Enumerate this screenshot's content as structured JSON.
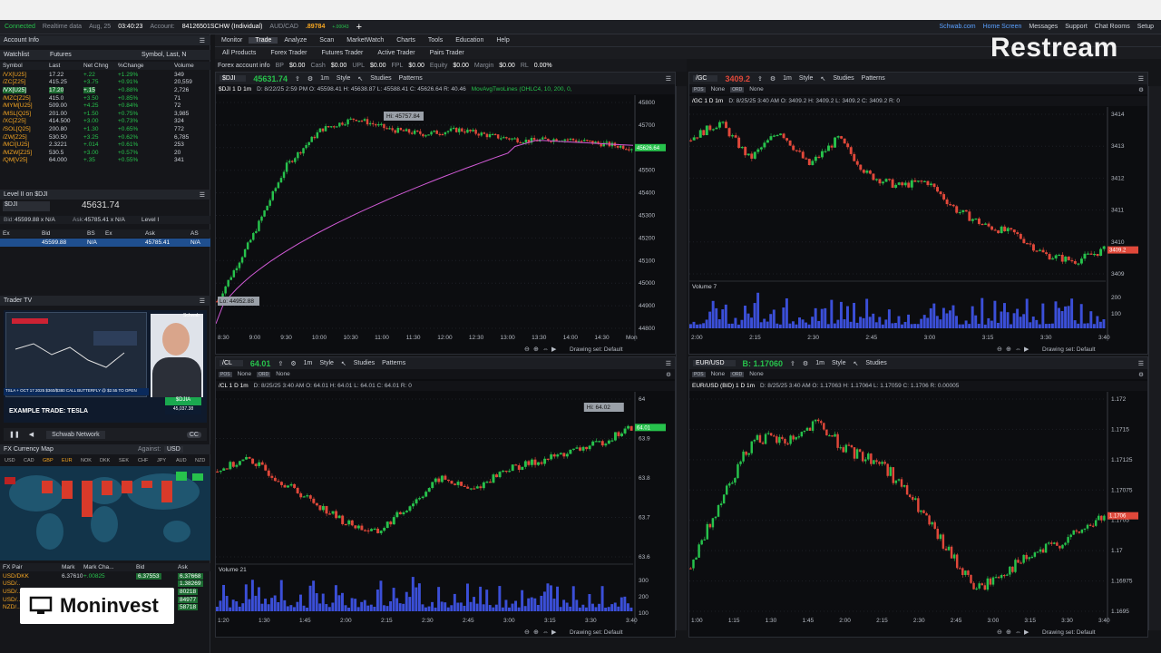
{
  "status": {
    "connected": "Connected",
    "realtime": "Realtime data",
    "date": "Aug, 25",
    "time": "03:40:23",
    "account_label": "Account:",
    "account": "84126501SCHW (Individual)",
    "pair": "AUD/CAD",
    "price": ".89784",
    "price_chg1": "+.00043",
    "price_chg2": "+0.05%"
  },
  "menu": {
    "items": [
      "Monitor",
      "Trade",
      "Analyze",
      "Scan",
      "MarketWatch",
      "Charts",
      "Tools",
      "Education",
      "Help"
    ],
    "active": "Trade"
  },
  "links": {
    "schwab": "Schwab.com",
    "home": "Home Screen",
    "messages": "Messages",
    "support": "Support",
    "chat": "Chat Rooms",
    "setup": "Setup",
    "ondemand": "OnDemand"
  },
  "subtabs": [
    "All Products",
    "Forex Trader",
    "Futures Trader",
    "Active Trader",
    "Pairs Trader"
  ],
  "fxinfo": {
    "label": "Forex account info",
    "bp": "BP",
    "bp_v": "$0.00",
    "cash": "Cash",
    "cash_v": "$0.00",
    "upl": "UPL",
    "upl_v": "$0.00",
    "fpl": "FPL",
    "fpl_v": "$0.00",
    "equity": "Equity",
    "equity_v": "$0.00",
    "margin": "Margin",
    "margin_v": "$0.00",
    "rl": "RL",
    "rl_v": "0.00%"
  },
  "left": {
    "account_info": "Account Info",
    "watchlist": {
      "title": "Watchlist",
      "list": "Futures",
      "sort": "Symbol, Last, N",
      "headers": [
        "Symbol",
        "Last",
        "Net Chng",
        "%Change",
        "Volume"
      ],
      "rows": [
        [
          "/VX[U25]",
          "17.22",
          "+.22",
          "+1.29%",
          "349"
        ],
        [
          "/ZC[Z25]",
          "415.25",
          "+3.75",
          "+0.91%",
          "20,559"
        ],
        [
          "/VX[U25]",
          "17.20",
          "+.15",
          "+0.88%",
          "2,726"
        ],
        [
          "/MZC[Z25]",
          "415.0",
          "+3.50",
          "+0.85%",
          "71"
        ],
        [
          "/MYM[U25]",
          "509.00",
          "+4.25",
          "+0.84%",
          "72"
        ],
        [
          "/MSL[Q25]",
          "201.00",
          "+1.50",
          "+0.75%",
          "3,985"
        ],
        [
          "/XC[Z25]",
          "414.500",
          "+3.00",
          "+0.73%",
          "324"
        ],
        [
          "/SOL[Q25]",
          "200.80",
          "+1.30",
          "+0.65%",
          "772"
        ],
        [
          "/ZW[Z25]",
          "530.50",
          "+3.25",
          "+0.62%",
          "6,785"
        ],
        [
          "/MCI[U25]",
          "2.3221",
          "+.014",
          "+0.61%",
          "253"
        ],
        [
          "/MZW[Z25]",
          "530.5",
          "+3.00",
          "+0.57%",
          "20"
        ],
        [
          "/QM[V25]",
          "64.000",
          "+.35",
          "+0.55%",
          "341"
        ]
      ]
    },
    "level2": {
      "title": "Level II on $DJI",
      "symbol": "$DJI",
      "price": "45631.74",
      "bid": "Bid:",
      "bid_v": "45599.88 x N/A",
      "ask": "Ask:",
      "ask_v": "45785.41 x N/A",
      "level": "Level I",
      "headers": [
        "Ex",
        "Bid",
        "BS",
        "Ex",
        "Ask",
        "AS"
      ],
      "row": [
        "",
        "45599.88",
        "N/A",
        "",
        "45785.41",
        "N/A"
      ]
    },
    "tradertv": {
      "title": "Trader TV",
      "caption": "EXAMPLE TRADE: TESLA",
      "network": "Schwab Network",
      "ticker": "TSLA + OCT 17 2025 $360/$380 CALL BUTTERFLY @ $2.55 TO OPEN",
      "badge": "$DJIA",
      "badge_val": "45,037.38",
      "brand": "Schwab"
    },
    "fxmap": {
      "title": "FX Currency Map",
      "against": "Against:",
      "against_v": "USD",
      "currencies": [
        "USD",
        "CAD",
        "GBP",
        "EUR",
        "NOK",
        "DKK",
        "SEK",
        "CHF",
        "JPY",
        "AUD",
        "NZD"
      ],
      "headers": [
        "FX Pair",
        "Mark",
        "Mark Cha...",
        "Bid",
        "Ask"
      ],
      "rows": [
        [
          "USD/DKK",
          "6.37610",
          "+.00825",
          "6.37553",
          "6.37668"
        ],
        [
          "USD/..",
          "",
          "",
          "",
          "1.38269"
        ],
        [
          "USD/..",
          "",
          "",
          "",
          "80218"
        ],
        [
          "USD/..",
          "",
          "",
          "",
          "84977"
        ],
        [
          "NZD/..",
          "",
          "",
          "",
          "58718"
        ]
      ]
    }
  },
  "charts": [
    {
      "id": "dji",
      "symbol": "$DJI",
      "price": "45631.74",
      "title": "$DJI 1 D 1m",
      "stat": "D: 8/22/25 2:59 PM   O: 45598.41   H: 45638.87   L: 45588.41   C: 45626.64   R: 40.46",
      "study": "MovAvgTwoLines (OHLC4, 10, 200, 0,",
      "hi": "Hi: 45757.84",
      "lo": "Lo: 44952.88",
      "last": "45626.64",
      "yticks": [
        "45800",
        "45700",
        "45600",
        "45500",
        "45400",
        "45300",
        "45200",
        "45100",
        "45000",
        "44900",
        "44800"
      ],
      "xticks": [
        "8:30",
        "9:00",
        "9:30",
        "10:00",
        "10:30",
        "11:00",
        "11:30",
        "12:00",
        "12:30",
        "13:00",
        "13:30",
        "14:00",
        "14:30",
        "Mon"
      ]
    },
    {
      "id": "gc",
      "symbol": "/GC",
      "price": "3409.2",
      "title": "/GC 1 D 1m",
      "stat": "D: 8/25/25 3:40 AM   O: 3409.2   H: 3409.2   L: 3409.2   C: 3409.2   R: 0",
      "last": "3409.2",
      "yticks": [
        "3414",
        "3413",
        "3412",
        "3411",
        "3410",
        "3409"
      ],
      "xticks": [
        "2:00",
        "2:15",
        "2:30",
        "2:45",
        "3:00",
        "3:15",
        "3:30",
        "3:40"
      ],
      "volume": "Volume",
      "volume_v": "7",
      "vticks": [
        "200",
        "100"
      ]
    },
    {
      "id": "cl",
      "symbol": "/CL",
      "price": "64.01",
      "title": "/CL 1 D 1m",
      "stat": "D: 8/25/25 3:40 AM   O: 64.01   H: 64.01   L: 64.01   C: 64.01   R: 0",
      "hi": "Hi: 64.02",
      "last": "64.01",
      "yticks": [
        "64",
        "63.9",
        "63.8",
        "63.7",
        "63.6"
      ],
      "xticks": [
        "1:20",
        "1:30",
        "1:45",
        "2:00",
        "2:15",
        "2:30",
        "2:45",
        "3:00",
        "3:15",
        "3:30",
        "3:40"
      ],
      "volume": "Volume",
      "volume_v": "21",
      "vticks": [
        "300",
        "200",
        "100"
      ]
    },
    {
      "id": "eur",
      "symbol": "EUR/USD",
      "price": "B: 1.17060",
      "title": "EUR/USD (BID) 1 D 1m",
      "stat": "D: 8/25/25 3:40 AM   O: 1.17063   H: 1.17064   L: 1.17059   C: 1.1706   R: 0.00005",
      "last": "1.1706",
      "yticks": [
        "1.172",
        "1.1715",
        "1.17125",
        "1.17075",
        "1.1705",
        "1.17",
        "1.16975",
        "1.1695"
      ],
      "xticks": [
        "1:00",
        "1:15",
        "1:30",
        "1:45",
        "2:00",
        "2:15",
        "2:30",
        "2:45",
        "3:00",
        "3:15",
        "3:30",
        "3:40"
      ]
    }
  ],
  "toolbar": {
    "style": "Style",
    "studies": "Studies",
    "patterns": "Patterns",
    "drawing": "Drawing set: Default",
    "period": "1m",
    "none": "None"
  },
  "overlay": {
    "restream": "Restream",
    "moninvest": "Moninvest"
  }
}
